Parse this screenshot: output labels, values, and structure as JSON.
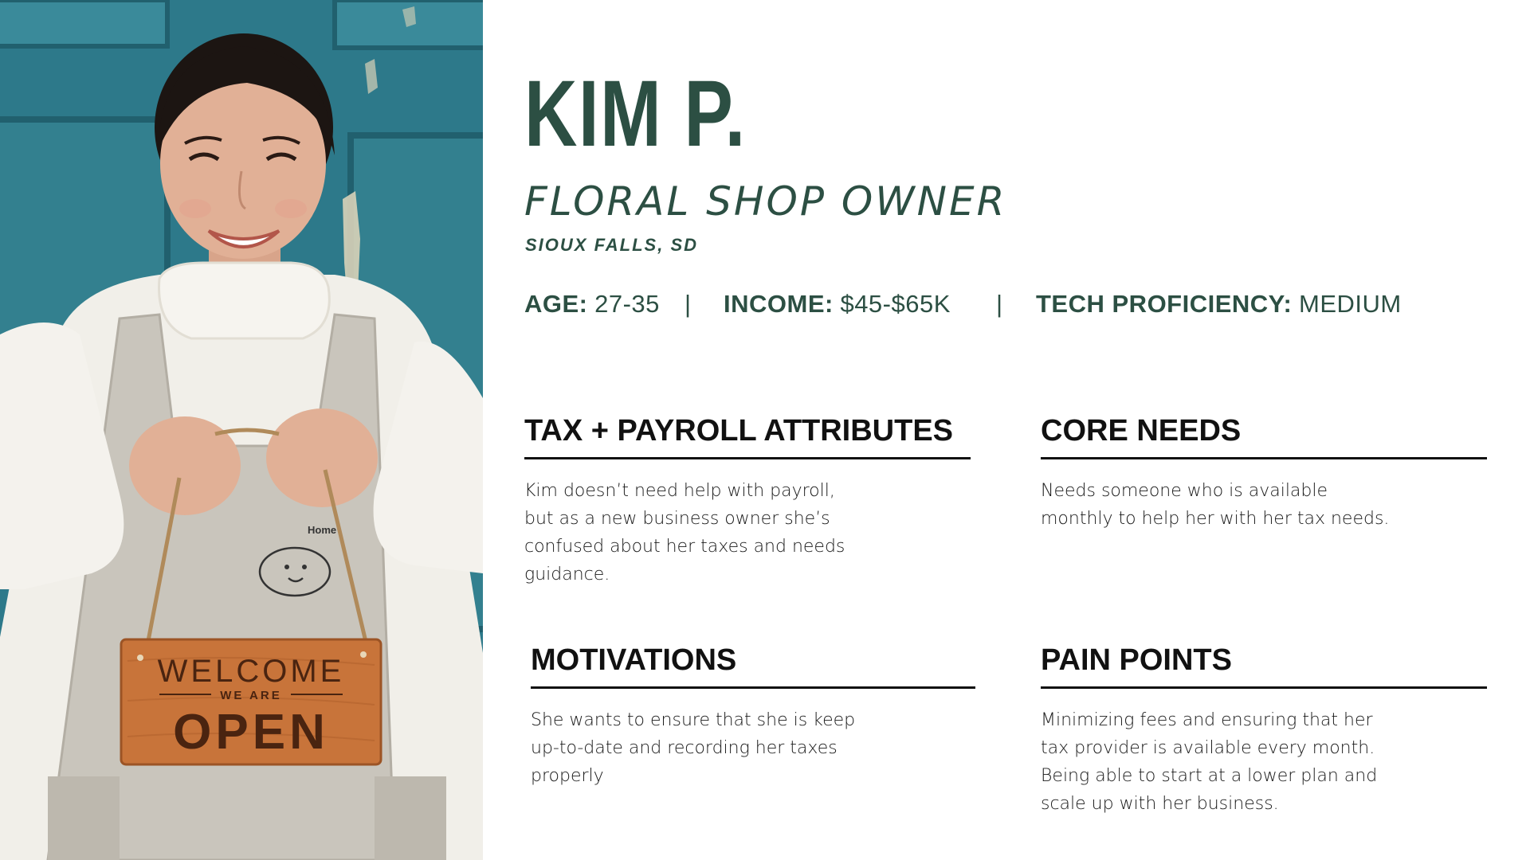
{
  "persona": {
    "name": "KIM P.",
    "role": "FLORAL SHOP OWNER",
    "location": "SIOUX FALLS, SD",
    "stats": [
      {
        "label": "AGE:",
        "value": "27-35"
      },
      {
        "label": "INCOME:",
        "value": "$45-$65K"
      },
      {
        "label": "TECH PROFICIENCY:",
        "value": "MEDIUM"
      }
    ],
    "separator": "|"
  },
  "sections": {
    "tax_payroll": {
      "title": "TAX + PAYROLL ATTRIBUTES",
      "lines": [
        "Kim doesn’t need help with payroll,",
        "but as a new business owner she’s",
        "confused about her taxes and needs",
        "guidance."
      ]
    },
    "core_needs": {
      "title": "CORE NEEDS",
      "lines": [
        "Needs someone who is available",
        "monthly to help her with her tax needs."
      ]
    },
    "motivations": {
      "title": "MOTIVATIONS",
      "lines": [
        "She wants to ensure that she is keep",
        "up-to-date and recording her taxes",
        "properly"
      ]
    },
    "pain_points": {
      "title": "PAIN POINTS",
      "lines": [
        "Minimizing fees and ensuring that her",
        "tax provider is available every month.",
        "Being able to start at a lower plan and",
        "scale up with her business."
      ]
    }
  },
  "photo": {
    "sign_line1": "WELCOME",
    "sign_line2": "WE ARE",
    "sign_line3": "OPEN",
    "apron_logo": "Home"
  },
  "colors": {
    "accent": "#2c4f43",
    "door": "#2f7f90",
    "text": "#111111"
  }
}
